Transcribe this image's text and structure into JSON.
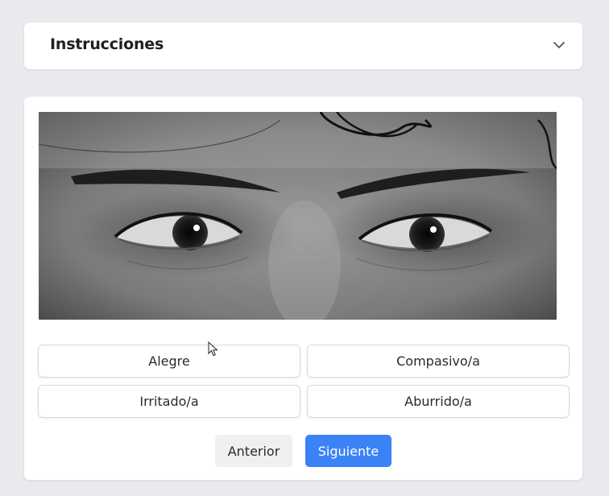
{
  "instructions": {
    "title": "Instrucciones",
    "toggle_icon": "chevron-down-icon"
  },
  "stimulus": {
    "image": "grayscale close-up photo of a person's eyes and eyebrows"
  },
  "options": [
    {
      "label": "Alegre"
    },
    {
      "label": "Compasivo/a"
    },
    {
      "label": "Irritado/a"
    },
    {
      "label": "Aburrido/a"
    }
  ],
  "navigation": {
    "previous_label": "Anterior",
    "next_label": "Siguiente"
  },
  "colors": {
    "page_background": "#e9eaed",
    "primary": "#3b82f6",
    "secondary_button": "#f0f0f0"
  }
}
